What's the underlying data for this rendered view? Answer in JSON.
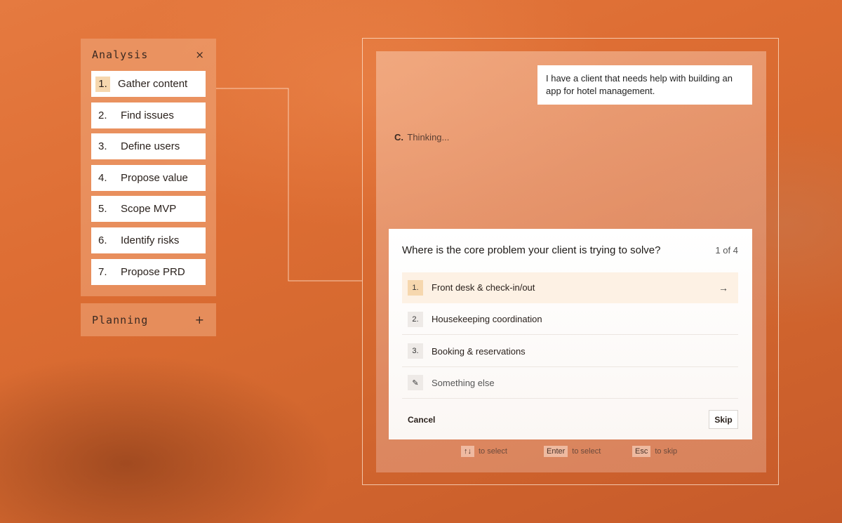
{
  "analysis": {
    "title": "Analysis",
    "close_icon": "×",
    "steps": [
      {
        "num": "1.",
        "label": "Gather content"
      },
      {
        "num": "2.",
        "label": "Find issues"
      },
      {
        "num": "3.",
        "label": "Define users"
      },
      {
        "num": "4.",
        "label": "Propose value"
      },
      {
        "num": "5.",
        "label": "Scope MVP"
      },
      {
        "num": "6.",
        "label": "Identify risks"
      },
      {
        "num": "7.",
        "label": "Propose PRD"
      }
    ]
  },
  "planning": {
    "title": "Planning",
    "plus_icon": "+"
  },
  "chat": {
    "user_message": "I have a client that needs help with building an app for hotel management.",
    "assistant_logo": "C.",
    "thinking_text": "Thinking..."
  },
  "question": {
    "title": "Where is the core problem your client is trying to solve?",
    "count": "1 of 4",
    "options": [
      {
        "num": "1.",
        "label": "Front desk & check-in/out"
      },
      {
        "num": "2.",
        "label": "Housekeeping coordination"
      },
      {
        "num": "3.",
        "label": "Booking & reservations"
      }
    ],
    "other_label": "Something else",
    "arrow_icon": "→",
    "pencil_icon": "✎",
    "cancel_label": "Cancel",
    "skip_label": "Skip"
  },
  "hints": [
    {
      "key": "↑↓",
      "text": "to select"
    },
    {
      "key": "Enter",
      "text": "to select"
    },
    {
      "key": "Esc",
      "text": "to skip"
    }
  ],
  "colors": {
    "accent": "#f6d7ae",
    "background": "#dd6d33"
  }
}
